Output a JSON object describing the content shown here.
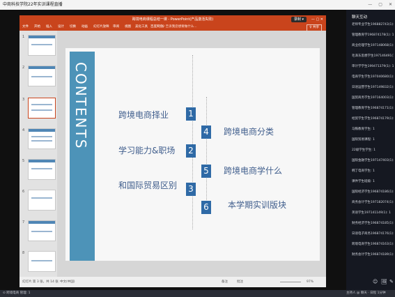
{
  "window": {
    "title": "中商科技学院22年实训课程直播",
    "controls": [
      "—",
      "▢",
      "✕"
    ]
  },
  "ppt": {
    "title": "跨境电商课程总结一课 - PowerPoint(产品激活失败)",
    "record_button": "录制 ▾",
    "window_controls": "—  ▢  ✕",
    "ribbon_tabs": [
      "文件",
      "开始",
      "插入",
      "设计",
      "切换",
      "动画",
      "幻灯片放映",
      "审阅",
      "视图",
      "美化工具",
      "百度网盘"
    ],
    "search_hint": "♀ 告诉我您想要做什么...",
    "share": "♀ 共享"
  },
  "thumbnails": [
    "1",
    "2",
    "3",
    "4",
    "5",
    "6",
    "7",
    "8"
  ],
  "slide": {
    "contents_word": "CONTENTS",
    "left_items": [
      {
        "text": "跨境电商择业",
        "num": "1"
      },
      {
        "text": "学习能力&职场",
        "num": "2"
      },
      {
        "text": "和国际贸易区别",
        "num": "3"
      }
    ],
    "right_items": [
      {
        "text": "跨境电商分类",
        "num": "4"
      },
      {
        "text": "跨境电商学什么",
        "num": "5"
      },
      {
        "text": "本学期实训版块",
        "num": "6"
      }
    ]
  },
  "status": {
    "slide_info": "幻灯片 第 3 张，共 14 张",
    "lang": "中文(中国)",
    "notes": "备注",
    "comments": "批注",
    "zoom": "97%"
  },
  "side": {
    "header": "聊天互动",
    "messages": [
      "老师专业学生196882743(1): 1",
      "管理教育学196874178(1): 1",
      "商业伦理学生197148068(1): 1",
      "毛泽东思想学生197146491(1): 1",
      "审计学学生199471379(1): 1",
      "电商学生学生197040680(1): 1",
      "日语运营学生197149832(1): 1",
      "国贸商务学生197164003(1): 1",
      "管理教育学生196874171(1): 1",
      "经贸学生学生196874179(1): 1",
      "马鞍教育学生: 1",
      "国际贸易课程: 1",
      "22级学生学生: 1",
      "国际金融学生197147403(1): 1",
      "韩丁电商学生: 1",
      "课件学生班级: 1",
      "国际经济学生196874186(1): 1",
      "商务会计学生197182074(1): 1",
      "英语学生197141149(1): 1",
      "财务经济学生196874185(1): 1",
      "日语电子商务196874176(1): 1",
      "跨境电商学生196874163(1): 1",
      "财务会计学生196874189(1): 1"
    ],
    "tools": [
      "☺",
      "🖼",
      "✎"
    ]
  },
  "bottom": {
    "left": "⊙ 跨境电商  管理: 1",
    "right": "主持人 @ 聊天 · 日程 1分钟"
  }
}
